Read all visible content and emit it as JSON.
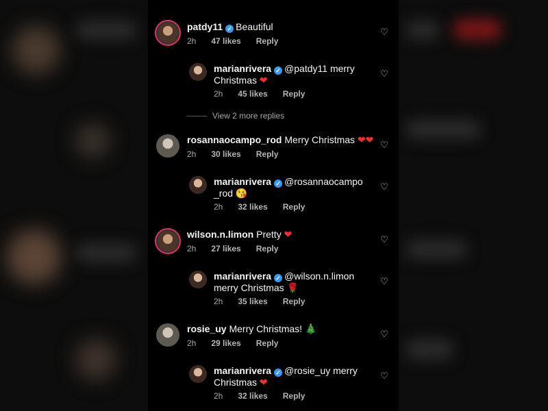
{
  "comments": [
    {
      "user": "patdy11",
      "text": "Beautiful",
      "time": "2h",
      "likes": "47 likes",
      "reply": "Reply",
      "verified": true
    },
    {
      "user": "marianrivera",
      "text": "@patdy11 merry",
      "text2": "Christmas",
      "emoji": "❤",
      "time": "2h",
      "likes": "45 likes",
      "reply": "Reply",
      "verified": true
    },
    {
      "user": "rosannaocampo_rod",
      "text": "Merry Christmas",
      "emoji": "❤❤",
      "time": "2h",
      "likes": "30 likes",
      "reply": "Reply",
      "verified": false
    },
    {
      "user": "marianrivera",
      "text": "@rosannaocampo",
      "text2": "_rod",
      "emoji": "😘",
      "time": "2h",
      "likes": "32 likes",
      "reply": "Reply",
      "verified": true
    },
    {
      "user": "wilson.n.limon",
      "text": "Pretty",
      "emoji": "❤",
      "time": "2h",
      "likes": "27 likes",
      "reply": "Reply",
      "verified": false
    },
    {
      "user": "marianrivera",
      "text": "@wilson.n.limon",
      "text2": "merry Christmas",
      "emoji": "🌹",
      "time": "2h",
      "likes": "35 likes",
      "reply": "Reply",
      "verified": true
    },
    {
      "user": "rosie_uy",
      "text": "Merry Christmas!",
      "emoji": "🎄",
      "time": "2h",
      "likes": "29 likes",
      "reply": "Reply",
      "verified": false
    },
    {
      "user": "marianrivera",
      "text": "@rosie_uy merry",
      "text2": "Christmas",
      "emoji": "❤",
      "time": "2h",
      "likes": "32 likes",
      "reply": "Reply",
      "verified": true
    }
  ],
  "view_more": "View 2 more replies",
  "icons": {
    "like": "heart-outline-icon",
    "verified": "verified-badge-icon"
  },
  "colors": {
    "background": "#000000",
    "verified": "#3897f0",
    "heart": "#ff2d2d",
    "ring": "#d9326b"
  }
}
